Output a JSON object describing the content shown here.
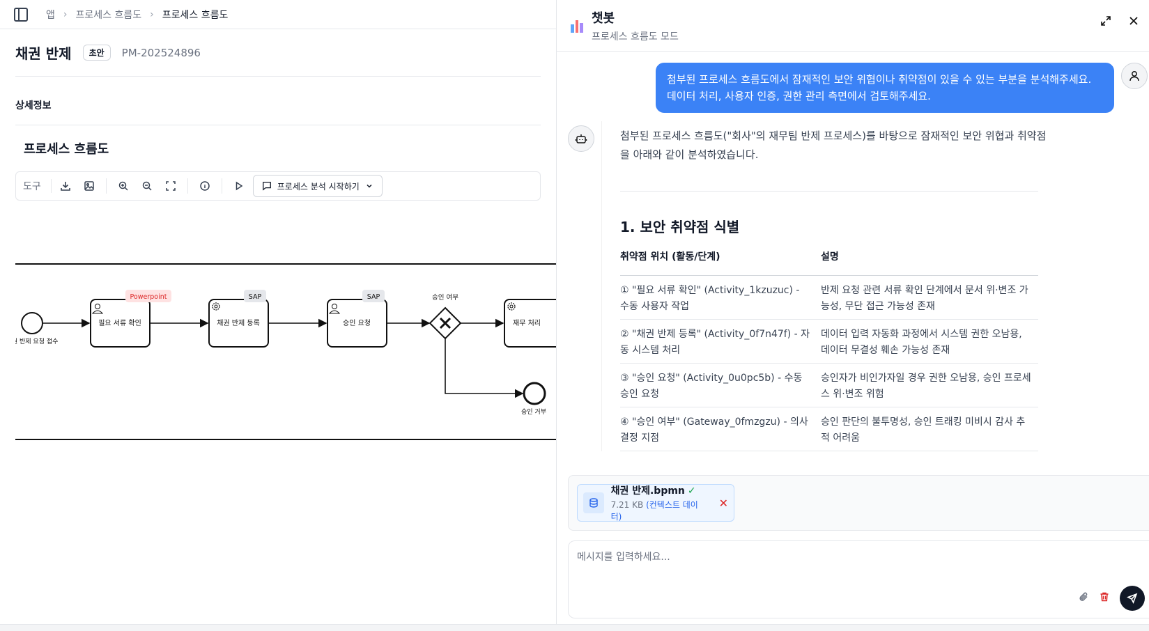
{
  "breadcrumb": {
    "items": [
      "앱",
      "프로세스 흐름도",
      "프로세스 흐름도"
    ]
  },
  "page": {
    "title": "채권 반제",
    "badge": "초안",
    "doc_id": "PM-202524896"
  },
  "section": {
    "details_label": "상세정보",
    "flow_title": "프로세스 흐름도"
  },
  "toolbar": {
    "label": "도구",
    "analyze_label": "프로세스 분석 시작하기"
  },
  "diagram": {
    "start_label": "채권 반제 요청 접수",
    "tasks": [
      {
        "name": "필요 서류 확인",
        "tag": "Powerpoint"
      },
      {
        "name": "채권 반제 등록",
        "tag": "SAP"
      },
      {
        "name": "승인 요청",
        "tag": "SAP"
      },
      {
        "name": "재무 처리",
        "tag": ""
      }
    ],
    "gateway_label": "승인 여부",
    "end_label": "승인 거부",
    "colors": {
      "powerpoint_tag": "#dc2626",
      "powerpoint_tag_bg": "#fee2e2",
      "sap_tag_bg": "#e5e7eb"
    }
  },
  "chat": {
    "title": "챗봇",
    "subtitle": "프로세스 흐름도 모드",
    "user_message": "첨부된 프로세스 흐름도에서 잠재적인 보안 위협이나 취약점이 있을 수 있는 부분을 분석해주세요. 데이터 처리, 사용자 인증, 권한 관리 측면에서 검토해주세요.",
    "bot_intro": "첨부된 프로세스 흐름도(\"회사\"의 재무팀 반제 프로세스)를 바탕으로 잠재적인 보안 위협과 취약점을 아래와 같이 분석하였습니다.",
    "section_heading": "1. 보안 취약점 식별",
    "table": {
      "headers": [
        "취약점 위치 (활동/단계)",
        "설명"
      ],
      "rows": [
        [
          "① \"필요 서류 확인\" (Activity_1kzuzuc) - 수동 사용자 작업",
          "반제 요청 관련 서류 확인 단계에서 문서 위·변조 가능성, 무단 접근 가능성 존재"
        ],
        [
          "② \"채권 반제 등록\" (Activity_0f7n47f) - 자동 시스템 처리",
          "데이터 입력 자동화 과정에서 시스템 권한 오남용, 데이터 무결성 훼손 가능성 존재"
        ],
        [
          "③ \"승인 요청\" (Activity_0u0pc5b) - 수동 승인 요청",
          "승인자가 비인가자일 경우 권한 오남용, 승인 프로세스 위·변조 위험"
        ],
        [
          "④ \"승인 여부\" (Gateway_0fmzgzu) - 의사결정 지점",
          "승인 판단의 불투명성, 승인 트래킹 미비시 감사 추적 어려움"
        ]
      ]
    },
    "attachment": {
      "name": "채권 반제.bpmn",
      "size": "7.21 KB",
      "context": "(컨텍스트 데이터)"
    },
    "input": {
      "placeholder": "메시지를 입력하세요..."
    },
    "accent": "#3b82f6"
  }
}
